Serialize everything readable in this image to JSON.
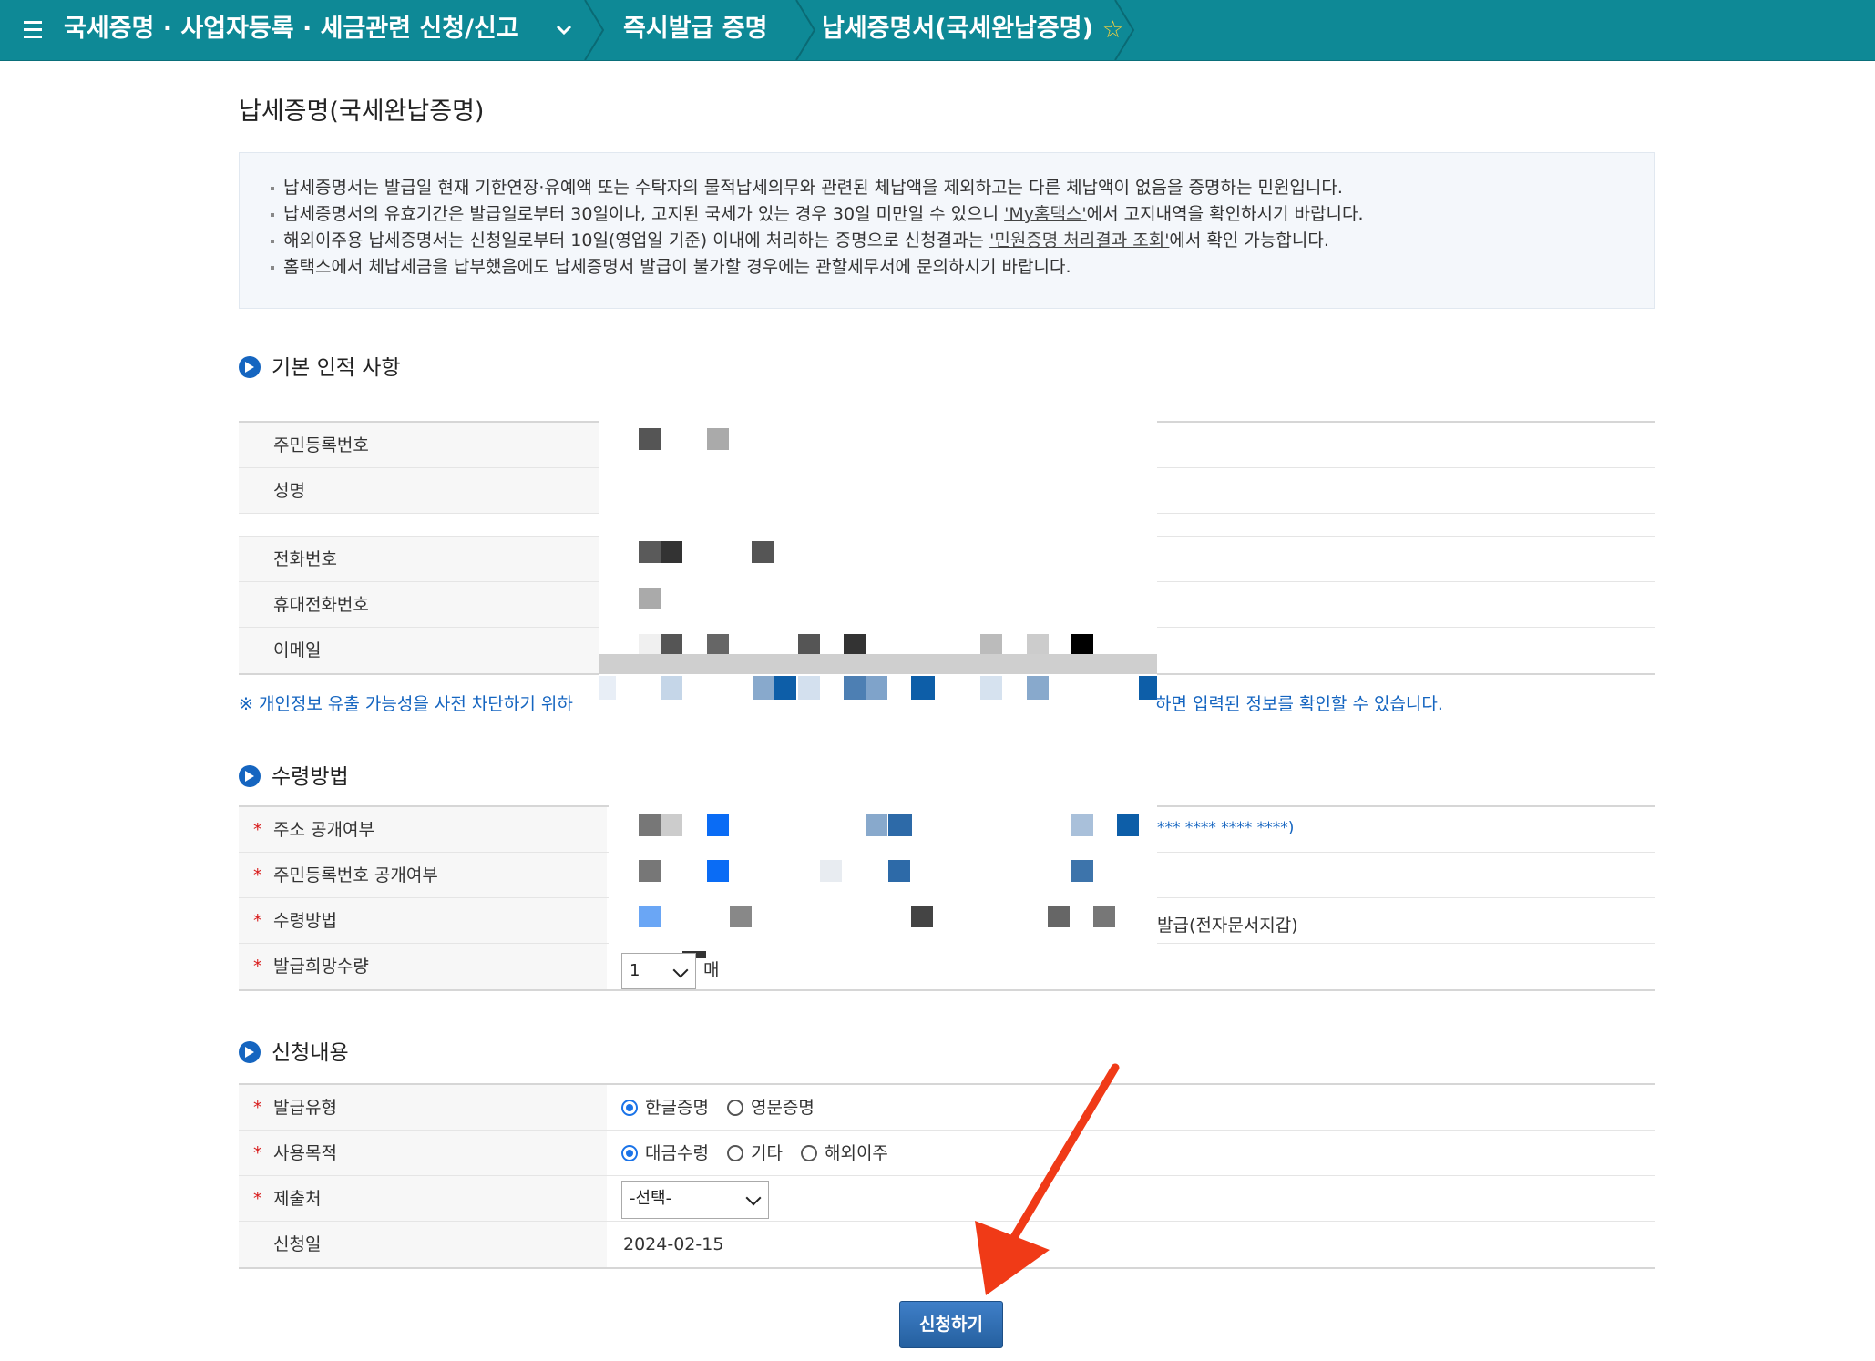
{
  "topbar": {
    "crumb1": "국세증명 · 사업자등록 · 세금관련 신청/신고",
    "crumb2": "즉시발급 증명",
    "crumb3": "납세증명서(국세완납증명)"
  },
  "page": {
    "title": "납세증명(국세완납증명)"
  },
  "info": {
    "line1": "납세증명서는 발급일 현재 기한연장·유예액 또는 수탁자의 물적납세의무와 관련된 체납액을 제외하고는 다른 체납액이 없음을 증명하는 민원입니다.",
    "line2_a": "납세증명서의 유효기간은 발급일로부터 30일이나, 고지된 국세가 있는 경우 30일 미만일 수 있으니 ",
    "line2_link": "'My홈택스'",
    "line2_b": "에서 고지내역을 확인하시기 바랍니다.",
    "line3_a": "해외이주용 납세증명서는 신청일로부터 10일(영업일 기준) 이내에 처리하는 증명으로 신청결과는 ",
    "line3_link": "'민원증명 처리결과 조회'",
    "line3_b": "에서 확인 가능합니다.",
    "line4": "홈택스에서 체납세금을 납부했음에도 납세증명서 발급이 불가할 경우에는 관할세무서에 문의하시기 바랍니다."
  },
  "section1": {
    "title": "기본 인적 사항",
    "labels": [
      "주민등록번호",
      "성명",
      "전화번호",
      "휴대전화번호",
      "이메일"
    ],
    "notice_a": "※ 개인정보 유출 가능성을 사전 차단하기 위하",
    "notice_b": "하면 입력된 정보를 확인할 수 있습니다."
  },
  "section2": {
    "title": "수령방법",
    "labels": [
      "주소 공개여부",
      "주민등록번호 공개여부",
      "수령방법",
      "발급희망수량"
    ],
    "masked_addr": "*** **** **** ****)",
    "issue_type": "발급(전자문서지갑)",
    "quantity": "1",
    "quantity_unit": "매"
  },
  "section3": {
    "title": "신청내용",
    "labels": [
      "발급유형",
      "사용목적",
      "제출처",
      "신청일"
    ],
    "issue_options": [
      "한글증명",
      "영문증명"
    ],
    "purpose_options": [
      "대금수령",
      "기타",
      "해외이주"
    ],
    "submit_to": "-선택-",
    "apply_date": "2024-02-15"
  },
  "submit_label": "신청하기",
  "colors": {
    "topbar": "#0e8996",
    "accent": "#1565c0",
    "arrow": "#f03a17"
  }
}
